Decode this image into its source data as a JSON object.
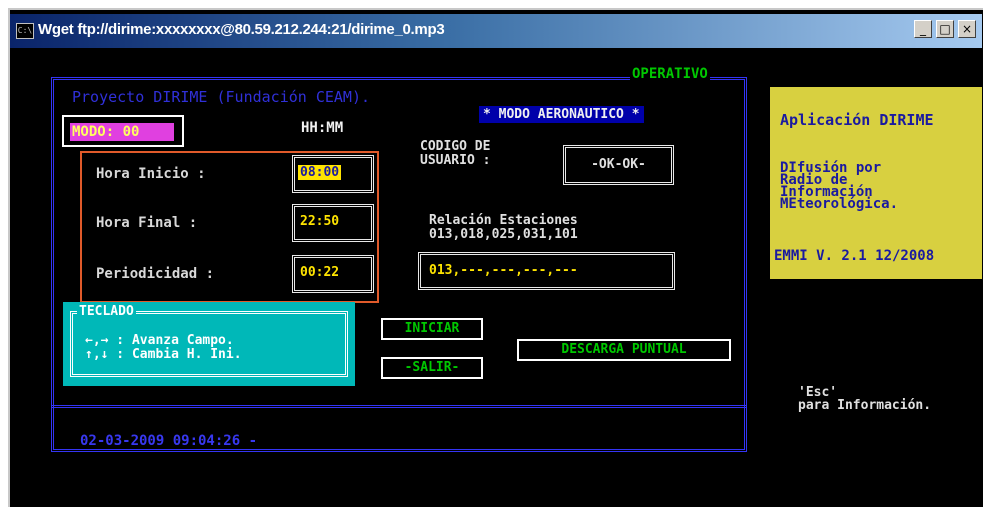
{
  "window": {
    "title": "Wget ftp://dirime:xxxxxxxx@80.59.212.244:21/dirime_0.mp3",
    "buttons": {
      "minimize": "_",
      "maximize": "□",
      "close": "×"
    }
  },
  "screen": {
    "status": "OPERATIVO",
    "project": "Proyecto DIRIME (Fundación CEAM).",
    "modo": "MODO: 00",
    "mode_banner": "* MODO AERONAUTICO *",
    "time_format": "HH:MM",
    "hora_inicio": {
      "label": "Hora  Inicio :",
      "value": "08:00"
    },
    "hora_final": {
      "label": "Hora  Final  :",
      "value": "22:50"
    },
    "periodicidad": {
      "label": "Periodicidad :",
      "value": "00:22"
    },
    "codigo_label_1": "CODIGO DE",
    "codigo_label_2": "USUARIO :",
    "codigo_value": "-OK-OK-",
    "relacion_title": "Relación Estaciones",
    "relacion_list": "013,018,025,031,101",
    "estaciones_value": "013,---,---,---,---",
    "teclado": {
      "title": "TECLADO",
      "line1": "←,→  : Avanza Campo.",
      "line2": "↑,↓  : Cambia H. Ini."
    },
    "btn_iniciar": "INICIAR",
    "btn_salir": "-SALIR-",
    "btn_descarga": "DESCARGA  PUNTUAL",
    "datetime": "02-03-2009  09:04:26 -"
  },
  "side_panel": {
    "title": "Aplicación DIRIME",
    "desc_1": "DIfusión por",
    "desc_2": "Radio de",
    "desc_3": "Información",
    "desc_4": "MEteorológica.",
    "version": "EMMI V. 2.1 12/2008",
    "esc_1": "'Esc'",
    "esc_2": "para Información."
  }
}
